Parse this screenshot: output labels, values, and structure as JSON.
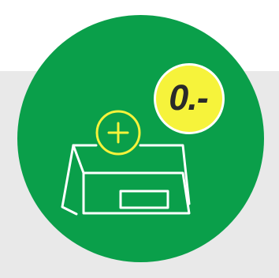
{
  "colors": {
    "background": "#ffffff",
    "band": "#e9e9e9",
    "circle": "#0a9f4a",
    "accent_yellow": "#f6f33b",
    "line_white": "#ffffff",
    "text_dark": "#2a2a2a"
  },
  "icons": {
    "main": "card-reader-icon",
    "add": "plus-circle-icon"
  },
  "price_badge": {
    "label": "0.-"
  }
}
